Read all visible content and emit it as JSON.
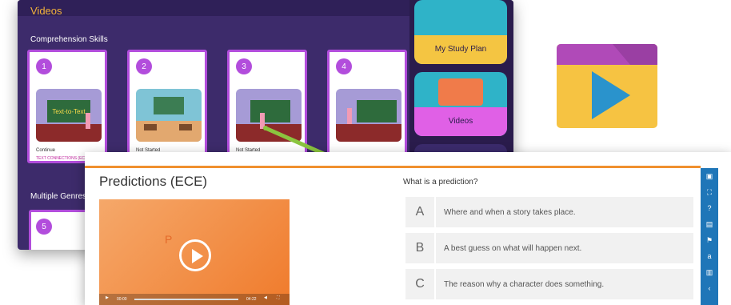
{
  "videos_panel": {
    "title": "Videos",
    "section_comprehension": "Comprehension Skills",
    "section_multiple": "Multiple Genres",
    "cards": [
      {
        "number": "1",
        "status": "Continue",
        "subtitle": "TEXT CONNECTIONS (ECE)",
        "thumb_text": "Text-to-Text"
      },
      {
        "number": "2",
        "status": "Not Started"
      },
      {
        "number": "3",
        "status": "Not Started"
      },
      {
        "number": "4",
        "status": ""
      }
    ],
    "card5_number": "5",
    "tiles": {
      "study_plan": "My Study Plan",
      "videos": "Videos"
    }
  },
  "predictions": {
    "title": "Predictions (ECE)",
    "video_letter": "P",
    "time_left": "00:00",
    "time_right": "04:22",
    "question": "What is a prediction?",
    "answers": [
      {
        "letter": "A",
        "text": "Where and when a story takes place."
      },
      {
        "letter": "B",
        "text": "A best guess on what will happen next."
      },
      {
        "letter": "C",
        "text": "The reason why a character does something."
      }
    ]
  },
  "colors": {
    "purple": "#3d2b6b",
    "card_border": "#b24ddc",
    "accent_orange": "#f0902e",
    "sidebar_blue": "#1f76b8",
    "arrow": "#8bc53f"
  }
}
